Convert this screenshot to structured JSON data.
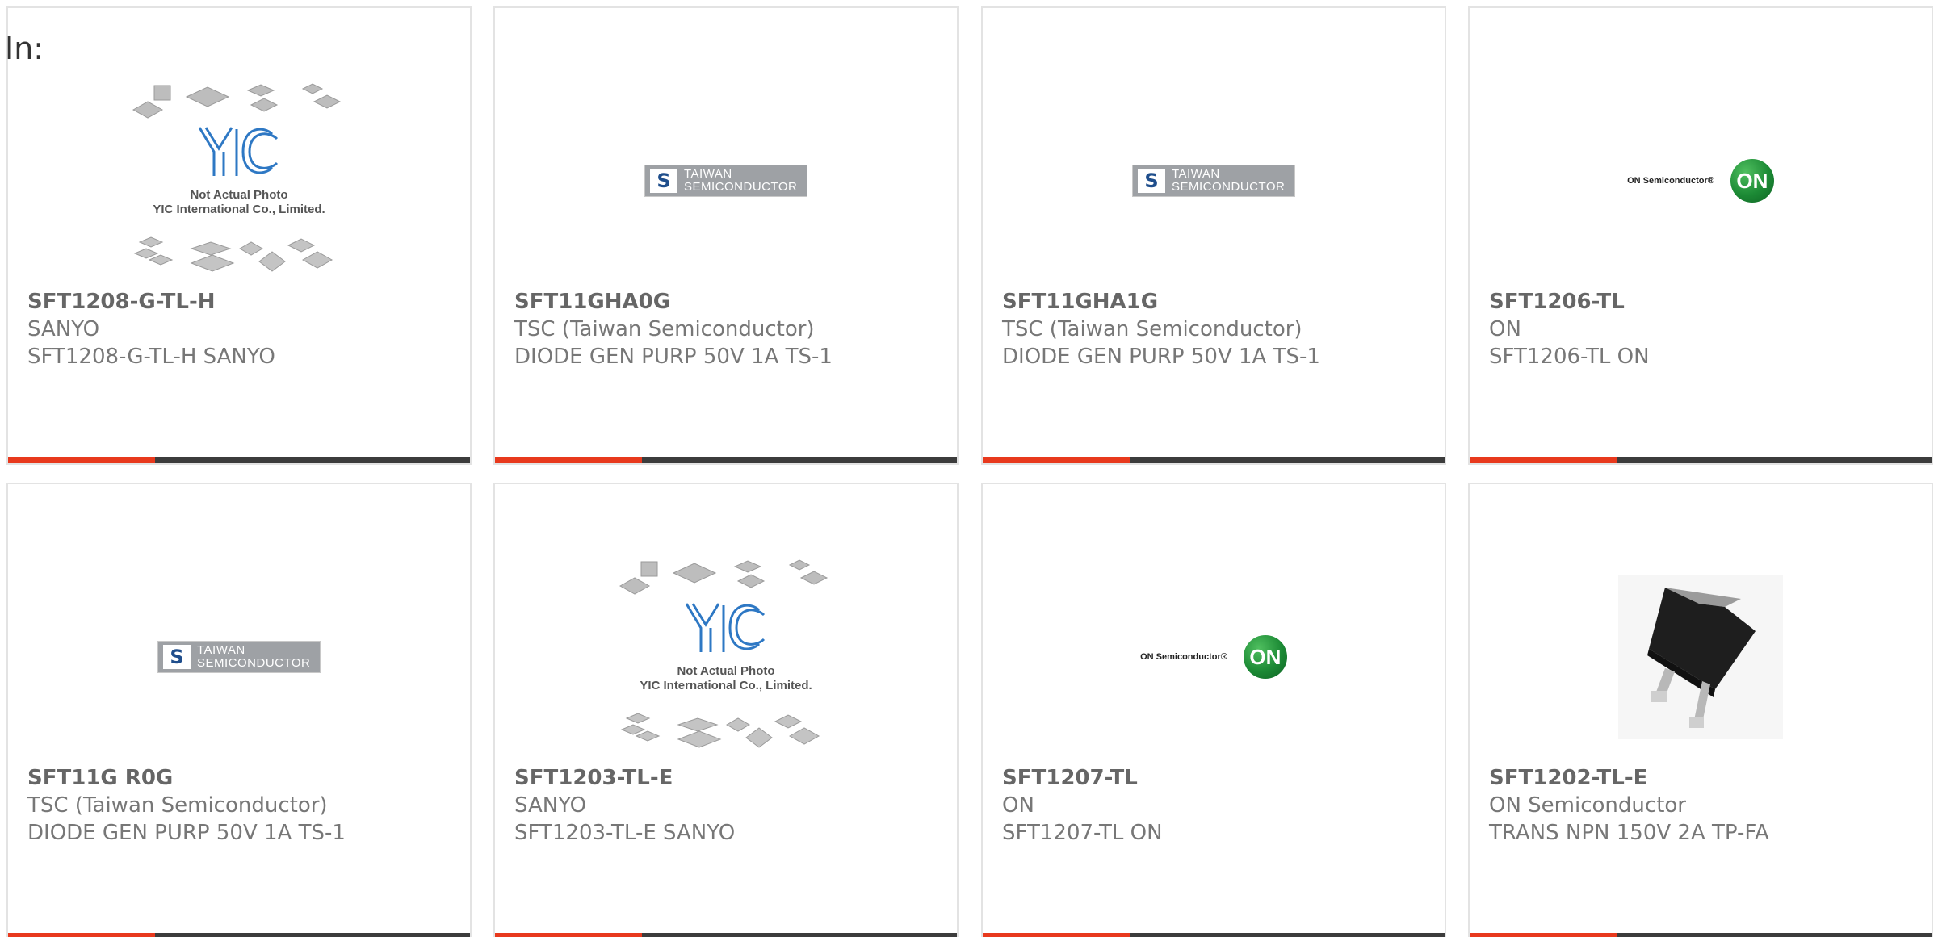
{
  "filter_label": "In:",
  "colors": {
    "accent": "#e8391d",
    "bar": "#3c3c3c",
    "card_border": "#e3e3e3"
  },
  "products": [
    {
      "part_number": "SFT1208-G-TL-H",
      "manufacturer": "SANYO",
      "description": "SFT1208-G-TL-H SANYO",
      "image": "yic-placeholder",
      "image_caption_1": "Not Actual Photo",
      "image_caption_2": "YIC International Co., Limited."
    },
    {
      "part_number": "SFT11GHA0G",
      "manufacturer": "TSC (Taiwan Semiconductor)",
      "description": "DIODE GEN PURP 50V 1A TS-1",
      "image": "taiwan-semiconductor-logo",
      "logo_line_1": "TAIWAN",
      "logo_line_2": "SEMICONDUCTOR"
    },
    {
      "part_number": "SFT11GHA1G",
      "manufacturer": "TSC (Taiwan Semiconductor)",
      "description": "DIODE GEN PURP 50V 1A TS-1",
      "image": "taiwan-semiconductor-logo",
      "logo_line_1": "TAIWAN",
      "logo_line_2": "SEMICONDUCTOR"
    },
    {
      "part_number": "SFT1206-TL",
      "manufacturer": "ON",
      "description": "SFT1206-TL ON",
      "image": "on-semiconductor-logo",
      "logo_text": "ON Semiconductor®",
      "logo_mark": "ON"
    },
    {
      "part_number": "SFT11G R0G",
      "manufacturer": "TSC (Taiwan Semiconductor)",
      "description": "DIODE GEN PURP 50V 1A TS-1",
      "image": "taiwan-semiconductor-logo",
      "logo_line_1": "TAIWAN",
      "logo_line_2": "SEMICONDUCTOR"
    },
    {
      "part_number": "SFT1203-TL-E",
      "manufacturer": "SANYO",
      "description": "SFT1203-TL-E SANYO",
      "image": "yic-placeholder",
      "image_caption_1": "Not Actual Photo",
      "image_caption_2": "YIC International Co., Limited."
    },
    {
      "part_number": "SFT1207-TL",
      "manufacturer": "ON",
      "description": "SFT1207-TL ON",
      "image": "on-semiconductor-logo",
      "logo_text": "ON Semiconductor®",
      "logo_mark": "ON"
    },
    {
      "part_number": "SFT1202-TL-E",
      "manufacturer": "ON Semiconductor",
      "description": "TRANS NPN 150V 2A TP-FA",
      "image": "to-252-package-photo"
    }
  ]
}
